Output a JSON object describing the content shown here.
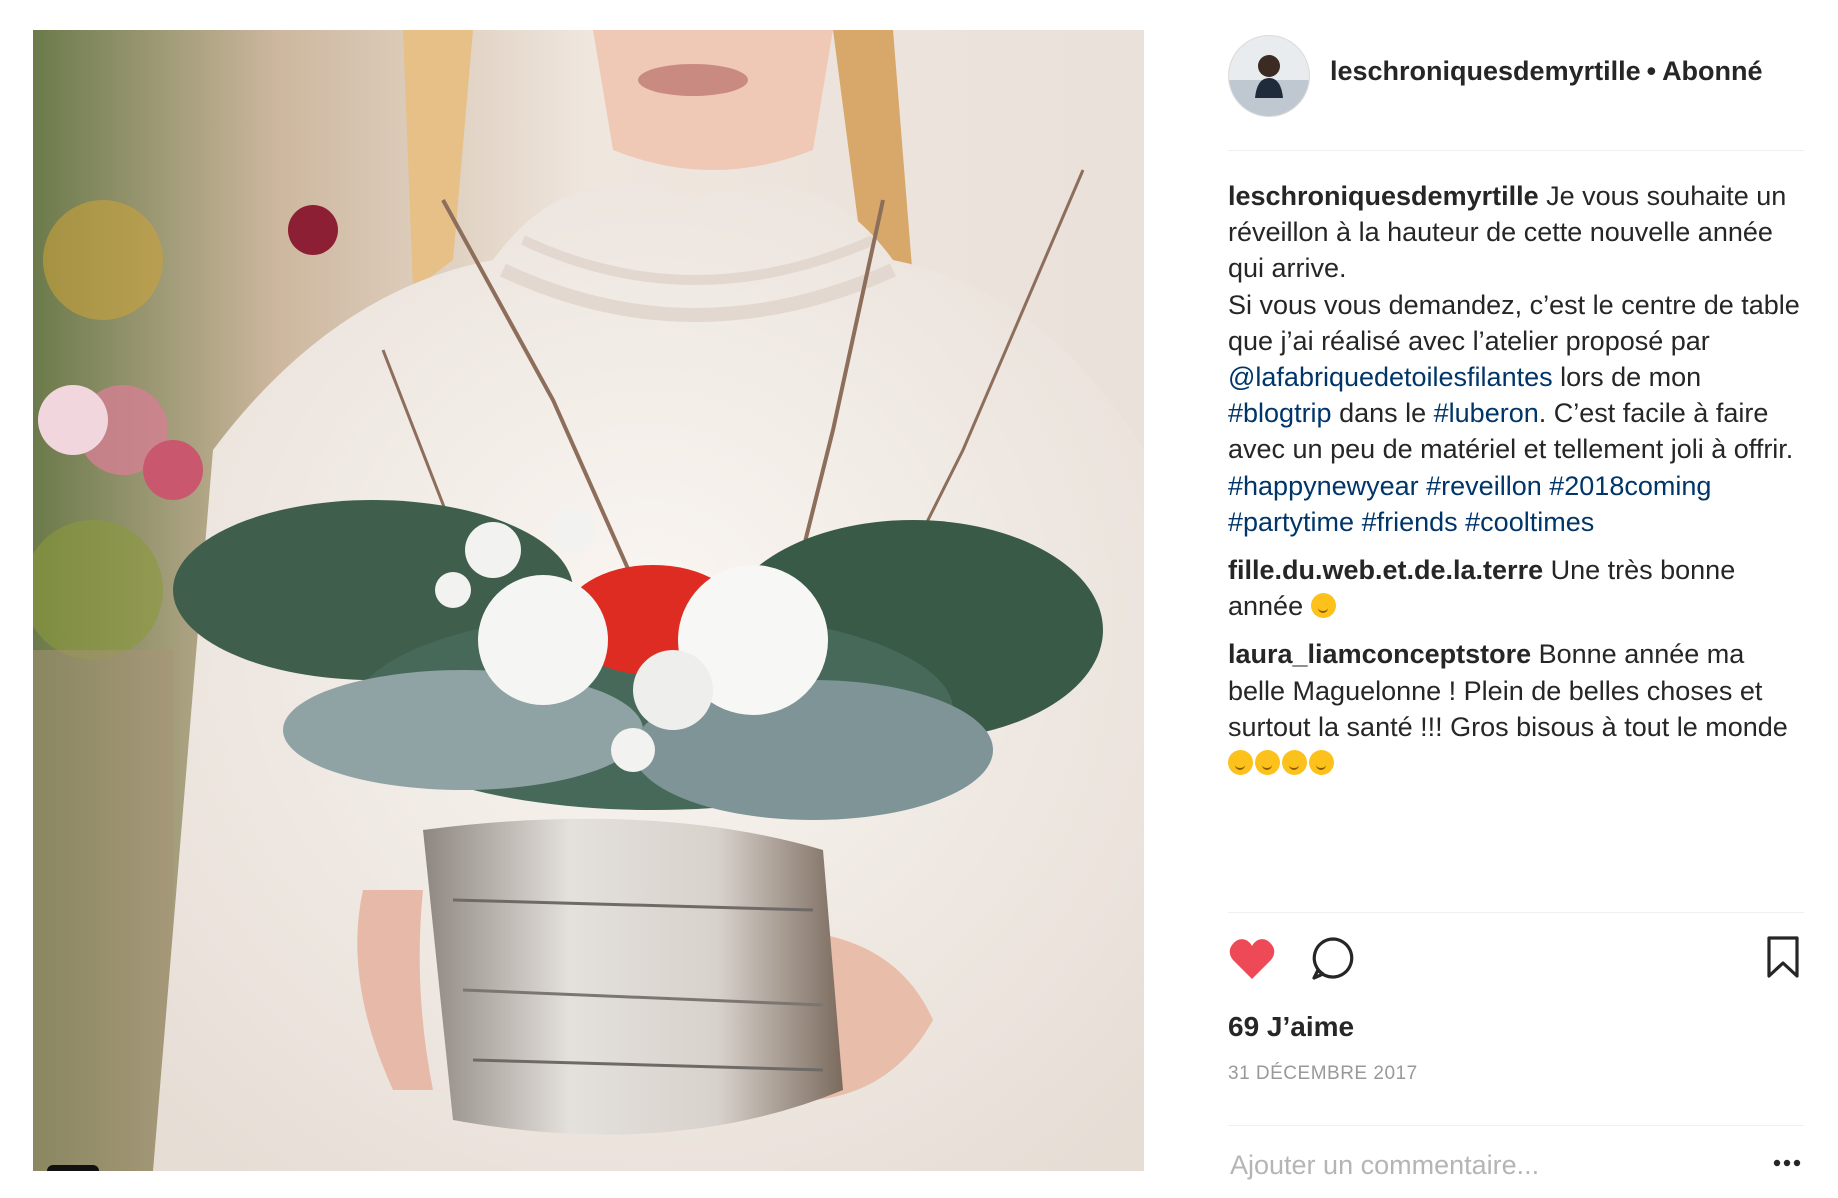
{
  "header": {
    "username": "leschroniquesdemyrtille",
    "separator": "•",
    "follow_label": "Abonné"
  },
  "comments": [
    {
      "username": "leschroniquesdemyrtille",
      "parts": [
        {
          "text": " Je vous souhaite un réveillon à la hauteur de cette nouvelle année qui arrive."
        },
        {
          "text": "\nSi vous vous demandez, c’est le centre de table que j’ai réalisé avec l’atelier proposé par "
        },
        {
          "text": "@lafabriquedetoilesfilantes",
          "link": true
        },
        {
          "text": " lors de mon "
        },
        {
          "text": "#blogtrip",
          "link": true
        },
        {
          "text": " dans le "
        },
        {
          "text": "#luberon",
          "link": true
        },
        {
          "text": ". C’est facile à faire avec un peu de matériel et tellement joli à offrir.\n"
        },
        {
          "text": "#happynewyear",
          "link": true
        },
        {
          "text": " "
        },
        {
          "text": "#reveillon",
          "link": true
        },
        {
          "text": " "
        },
        {
          "text": "#2018coming",
          "link": true
        },
        {
          "text": " "
        },
        {
          "text": "#partytime",
          "link": true
        },
        {
          "text": " "
        },
        {
          "text": "#friends",
          "link": true
        },
        {
          "text": " "
        },
        {
          "text": "#cooltimes",
          "link": true
        }
      ]
    },
    {
      "username": "fille.du.web.et.de.la.terre",
      "parts": [
        {
          "text": " Une très bonne année "
        }
      ],
      "emoji_count": 1
    },
    {
      "username": "laura_liamconceptstore",
      "parts": [
        {
          "text": " Bonne année ma belle Maguelonne ! Plein de belles choses et surtout la santé !!! Gros bisous à tout le monde "
        }
      ],
      "emoji_count": 4
    }
  ],
  "actions": {
    "likes": "69 J’aime",
    "date": "31 DÉCEMBRE 2017",
    "comment_placeholder": "Ajouter un commentaire...",
    "like_color": "#ed4956"
  },
  "icons": [
    "heart-icon",
    "comment-icon",
    "bookmark-icon",
    "more-icon",
    "user-tag-icon"
  ]
}
